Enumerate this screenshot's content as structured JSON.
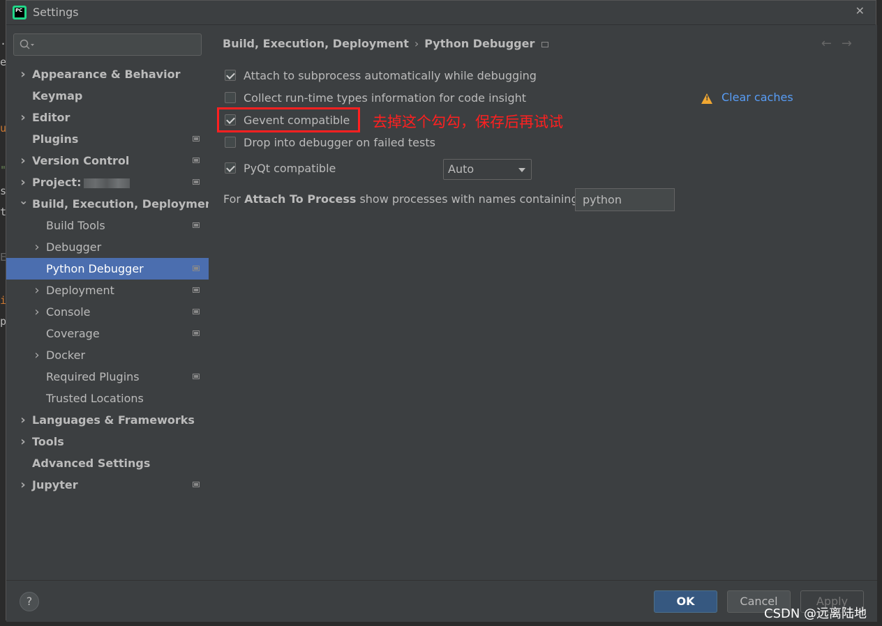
{
  "window": {
    "title": "Settings",
    "app_icon": "pycharm-icon"
  },
  "sidebar": {
    "search_placeholder": "",
    "items": [
      {
        "label": "Appearance & Behavior",
        "expandable": true,
        "bold": true,
        "level": 0
      },
      {
        "label": "Keymap",
        "expandable": false,
        "bold": true,
        "level": 0
      },
      {
        "label": "Editor",
        "expandable": true,
        "bold": true,
        "level": 0
      },
      {
        "label": "Plugins",
        "expandable": false,
        "bold": true,
        "level": 0,
        "project_icon": true
      },
      {
        "label": "Version Control",
        "expandable": true,
        "bold": true,
        "level": 0,
        "project_icon": true
      },
      {
        "label": "Project:",
        "expandable": true,
        "bold": true,
        "level": 0,
        "project_icon": true,
        "blurred": true
      },
      {
        "label": "Build, Execution, Deployment",
        "expandable": true,
        "expanded": true,
        "bold": true,
        "level": 0
      },
      {
        "label": "Build Tools",
        "expandable": false,
        "level": 1,
        "project_icon": true
      },
      {
        "label": "Debugger",
        "expandable": true,
        "level": 1
      },
      {
        "label": "Python Debugger",
        "expandable": false,
        "level": 1,
        "project_icon": true,
        "selected": true
      },
      {
        "label": "Deployment",
        "expandable": true,
        "level": 1,
        "project_icon": true
      },
      {
        "label": "Console",
        "expandable": true,
        "level": 1,
        "project_icon": true
      },
      {
        "label": "Coverage",
        "expandable": false,
        "level": 1,
        "project_icon": true
      },
      {
        "label": "Docker",
        "expandable": true,
        "level": 1
      },
      {
        "label": "Required Plugins",
        "expandable": false,
        "level": 1,
        "project_icon": true
      },
      {
        "label": "Trusted Locations",
        "expandable": false,
        "level": 1
      },
      {
        "label": "Languages & Frameworks",
        "expandable": true,
        "bold": true,
        "level": 0
      },
      {
        "label": "Tools",
        "expandable": true,
        "bold": true,
        "level": 0
      },
      {
        "label": "Advanced Settings",
        "expandable": false,
        "bold": true,
        "level": 0
      },
      {
        "label": "Jupyter",
        "expandable": true,
        "bold": true,
        "level": 0,
        "project_icon": true
      }
    ]
  },
  "breadcrumb": {
    "parent": "Build, Execution, Deployment",
    "separator": "›",
    "current": "Python Debugger"
  },
  "options": {
    "attach_subprocess": {
      "label": "Attach to subprocess automatically while debugging",
      "checked": true
    },
    "collect_types": {
      "label": "Collect run-time types information for code insight",
      "checked": false
    },
    "gevent": {
      "label": "Gevent compatible",
      "checked": true
    },
    "drop_into_debugger": {
      "label": "Drop into debugger on failed tests",
      "checked": false
    },
    "pyqt": {
      "label": "PyQt compatible",
      "checked": true
    }
  },
  "clear_caches_label": "Clear caches",
  "pyqt_select_value": "Auto",
  "attach_to_process": {
    "prefix": "For ",
    "bold": "Attach To Process",
    "suffix": " show processes with names containing:",
    "value": "python"
  },
  "annotation": "去掉这个勾勾，保存后再试试",
  "buttons": {
    "help": "?",
    "ok": "OK",
    "cancel": "Cancel",
    "apply": "Apply"
  },
  "watermark": "CSDN @远离陆地",
  "colors": {
    "accent": "#4b6eaf",
    "link": "#589df6",
    "warning": "#f0a732",
    "annotation_red": "#ff2020"
  }
}
